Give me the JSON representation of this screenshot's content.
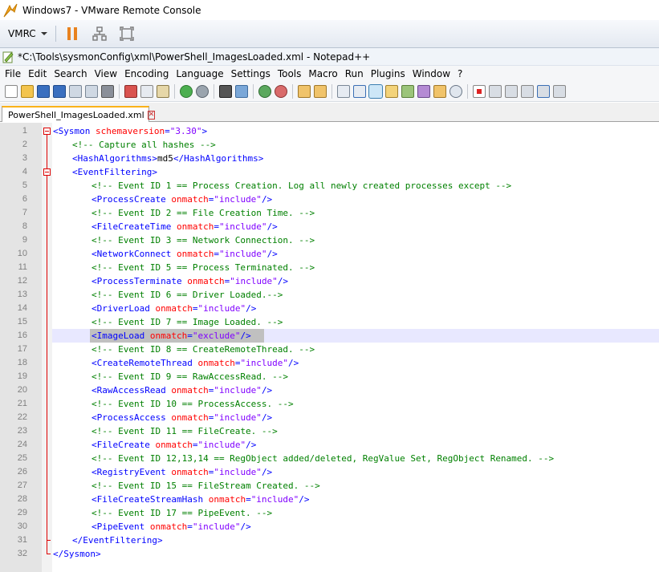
{
  "vm_window": {
    "title": "Windows7 - VMware Remote Console",
    "menu_label": "VMRC"
  },
  "app": {
    "title": "*C:\\Tools\\sysmonConfig\\xml\\PowerShell_ImagesLoaded.xml - Notepad++"
  },
  "menu": [
    "File",
    "Edit",
    "Search",
    "View",
    "Encoding",
    "Language",
    "Settings",
    "Tools",
    "Macro",
    "Run",
    "Plugins",
    "Window",
    "?"
  ],
  "tab": {
    "label": "PowerShell_ImagesLoaded.xml",
    "close": "✕"
  },
  "editor": {
    "current_line": 16,
    "lines": [
      {
        "n": "1",
        "indent": 0,
        "parts": [
          [
            "tag",
            "<Sysmon "
          ],
          [
            "attr",
            "schemaversion"
          ],
          [
            "tag",
            "="
          ],
          [
            "val",
            "\"3.30\""
          ],
          [
            "tag",
            ">"
          ]
        ]
      },
      {
        "n": "2",
        "indent": 1,
        "parts": [
          [
            "cmt",
            "<!-- Capture all hashes -->"
          ]
        ]
      },
      {
        "n": "3",
        "indent": 1,
        "parts": [
          [
            "tag",
            "<HashAlgorithms>"
          ],
          [
            "text",
            "md5"
          ],
          [
            "tag",
            "</HashAlgorithms>"
          ]
        ]
      },
      {
        "n": "4",
        "indent": 1,
        "parts": [
          [
            "tag",
            "<EventFiltering>"
          ]
        ]
      },
      {
        "n": "5",
        "indent": 2,
        "parts": [
          [
            "cmt",
            "<!-- Event ID 1 == Process Creation. Log all newly created processes except -->"
          ]
        ]
      },
      {
        "n": "6",
        "indent": 2,
        "parts": [
          [
            "tag",
            "<ProcessCreate "
          ],
          [
            "attr",
            "onmatch"
          ],
          [
            "tag",
            "="
          ],
          [
            "val",
            "\"include\""
          ],
          [
            "tag",
            "/>"
          ]
        ]
      },
      {
        "n": "7",
        "indent": 2,
        "parts": [
          [
            "cmt",
            "<!-- Event ID 2 == File Creation Time. -->"
          ]
        ]
      },
      {
        "n": "8",
        "indent": 2,
        "parts": [
          [
            "tag",
            "<FileCreateTime "
          ],
          [
            "attr",
            "onmatch"
          ],
          [
            "tag",
            "="
          ],
          [
            "val",
            "\"include\""
          ],
          [
            "tag",
            "/>"
          ]
        ]
      },
      {
        "n": "9",
        "indent": 2,
        "parts": [
          [
            "cmt",
            "<!-- Event ID 3 == Network Connection. -->"
          ]
        ]
      },
      {
        "n": "10",
        "indent": 2,
        "parts": [
          [
            "tag",
            "<NetworkConnect "
          ],
          [
            "attr",
            "onmatch"
          ],
          [
            "tag",
            "="
          ],
          [
            "val",
            "\"include\""
          ],
          [
            "tag",
            "/>"
          ]
        ]
      },
      {
        "n": "11",
        "indent": 2,
        "parts": [
          [
            "cmt",
            "<!-- Event ID 5 == Process Terminated. -->"
          ]
        ]
      },
      {
        "n": "12",
        "indent": 2,
        "parts": [
          [
            "tag",
            "<ProcessTerminate "
          ],
          [
            "attr",
            "onmatch"
          ],
          [
            "tag",
            "="
          ],
          [
            "val",
            "\"include\""
          ],
          [
            "tag",
            "/>"
          ]
        ]
      },
      {
        "n": "13",
        "indent": 2,
        "parts": [
          [
            "cmt",
            "<!-- Event ID 6 == Driver Loaded.-->"
          ]
        ]
      },
      {
        "n": "14",
        "indent": 2,
        "parts": [
          [
            "tag",
            "<DriverLoad "
          ],
          [
            "attr",
            "onmatch"
          ],
          [
            "tag",
            "="
          ],
          [
            "val",
            "\"include\""
          ],
          [
            "tag",
            "/>"
          ]
        ]
      },
      {
        "n": "15",
        "indent": 2,
        "parts": [
          [
            "cmt",
            "<!-- Event ID 7 == Image Loaded. -->"
          ]
        ]
      },
      {
        "n": "16",
        "indent": 2,
        "parts": [
          [
            "tag",
            "<ImageLoad "
          ],
          [
            "attr",
            "onmatch"
          ],
          [
            "tag",
            "="
          ],
          [
            "val",
            "\"exclude\""
          ],
          [
            "tag",
            "/>"
          ]
        ]
      },
      {
        "n": "17",
        "indent": 2,
        "parts": [
          [
            "cmt",
            "<!-- Event ID 8 == CreateRemoteThread. -->"
          ]
        ]
      },
      {
        "n": "18",
        "indent": 2,
        "parts": [
          [
            "tag",
            "<CreateRemoteThread "
          ],
          [
            "attr",
            "onmatch"
          ],
          [
            "tag",
            "="
          ],
          [
            "val",
            "\"include\""
          ],
          [
            "tag",
            "/>"
          ]
        ]
      },
      {
        "n": "19",
        "indent": 2,
        "parts": [
          [
            "cmt",
            "<!-- Event ID 9 == RawAccessRead. -->"
          ]
        ]
      },
      {
        "n": "20",
        "indent": 2,
        "parts": [
          [
            "tag",
            "<RawAccessRead "
          ],
          [
            "attr",
            "onmatch"
          ],
          [
            "tag",
            "="
          ],
          [
            "val",
            "\"include\""
          ],
          [
            "tag",
            "/>"
          ]
        ]
      },
      {
        "n": "21",
        "indent": 2,
        "parts": [
          [
            "cmt",
            "<!-- Event ID 10 == ProcessAccess. -->"
          ]
        ]
      },
      {
        "n": "22",
        "indent": 2,
        "parts": [
          [
            "tag",
            "<ProcessAccess "
          ],
          [
            "attr",
            "onmatch"
          ],
          [
            "tag",
            "="
          ],
          [
            "val",
            "\"include\""
          ],
          [
            "tag",
            "/>"
          ]
        ]
      },
      {
        "n": "23",
        "indent": 2,
        "parts": [
          [
            "cmt",
            "<!-- Event ID 11 == FileCreate. -->"
          ]
        ]
      },
      {
        "n": "24",
        "indent": 2,
        "parts": [
          [
            "tag",
            "<FileCreate "
          ],
          [
            "attr",
            "onmatch"
          ],
          [
            "tag",
            "="
          ],
          [
            "val",
            "\"include\""
          ],
          [
            "tag",
            "/>"
          ]
        ]
      },
      {
        "n": "25",
        "indent": 2,
        "parts": [
          [
            "cmt",
            "<!-- Event ID 12,13,14 == RegObject added/deleted, RegValue Set, RegObject Renamed. -->"
          ]
        ]
      },
      {
        "n": "26",
        "indent": 2,
        "parts": [
          [
            "tag",
            "<RegistryEvent "
          ],
          [
            "attr",
            "onmatch"
          ],
          [
            "tag",
            "="
          ],
          [
            "val",
            "\"include\""
          ],
          [
            "tag",
            "/>"
          ]
        ]
      },
      {
        "n": "27",
        "indent": 2,
        "parts": [
          [
            "cmt",
            "<!-- Event ID 15 == FileStream Created. -->"
          ]
        ]
      },
      {
        "n": "28",
        "indent": 2,
        "parts": [
          [
            "tag",
            "<FileCreateStreamHash "
          ],
          [
            "attr",
            "onmatch"
          ],
          [
            "tag",
            "="
          ],
          [
            "val",
            "\"include\""
          ],
          [
            "tag",
            "/>"
          ]
        ]
      },
      {
        "n": "29",
        "indent": 2,
        "parts": [
          [
            "cmt",
            "<!-- Event ID 17 == PipeEvent. -->"
          ]
        ]
      },
      {
        "n": "30",
        "indent": 2,
        "parts": [
          [
            "tag",
            "<PipeEvent "
          ],
          [
            "attr",
            "onmatch"
          ],
          [
            "tag",
            "="
          ],
          [
            "val",
            "\"include\""
          ],
          [
            "tag",
            "/>"
          ]
        ]
      },
      {
        "n": "31",
        "indent": 1,
        "parts": [
          [
            "tag",
            "</EventFiltering>"
          ]
        ]
      },
      {
        "n": "32",
        "indent": 0,
        "parts": [
          [
            "tag",
            "</Sysmon>"
          ]
        ]
      }
    ]
  },
  "colors": {
    "tag": "#0000ff",
    "attribute": "#ff0000",
    "value": "#8000ff",
    "comment": "#008000",
    "current_line": "#e8e8ff",
    "selection": "#c0c0c0",
    "gutter": "#e4e4e4"
  }
}
